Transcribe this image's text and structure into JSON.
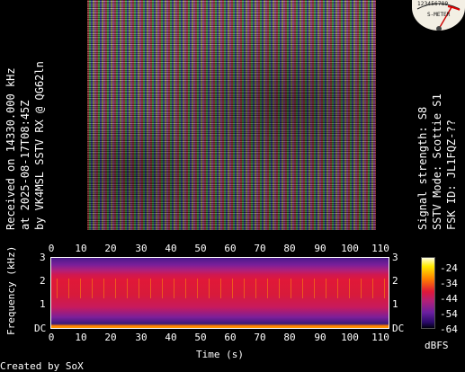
{
  "left_caption": [
    "Received on  14330.000 kHz",
    "at 2025-08-17T08:45Z",
    "by VK4MSL SSTV RX @ QG62ln"
  ],
  "right_caption": [
    "Signal strength: S8",
    "SSTV Mode: Scottie S1",
    "FSK ID: JL1FQZ-??"
  ],
  "meter": {
    "scale_digits": "123456789",
    "label": "S-METER"
  },
  "spectrogram": {
    "x_ticks": [
      "0",
      "10",
      "20",
      "30",
      "40",
      "50",
      "60",
      "70",
      "80",
      "90",
      "100",
      "110"
    ],
    "y_ticks_left": [
      "3",
      "2",
      "1",
      "DC"
    ],
    "y_ticks_right": [
      "3",
      "2",
      "1",
      "DC"
    ],
    "ylabel": "Frequency (kHz)",
    "xlabel": "Time (s)"
  },
  "colorbar": {
    "ticks": [
      "-24",
      "-34",
      "-44",
      "-54",
      "-64"
    ],
    "unit": "dBFS"
  },
  "footer": "Created by SoX"
}
